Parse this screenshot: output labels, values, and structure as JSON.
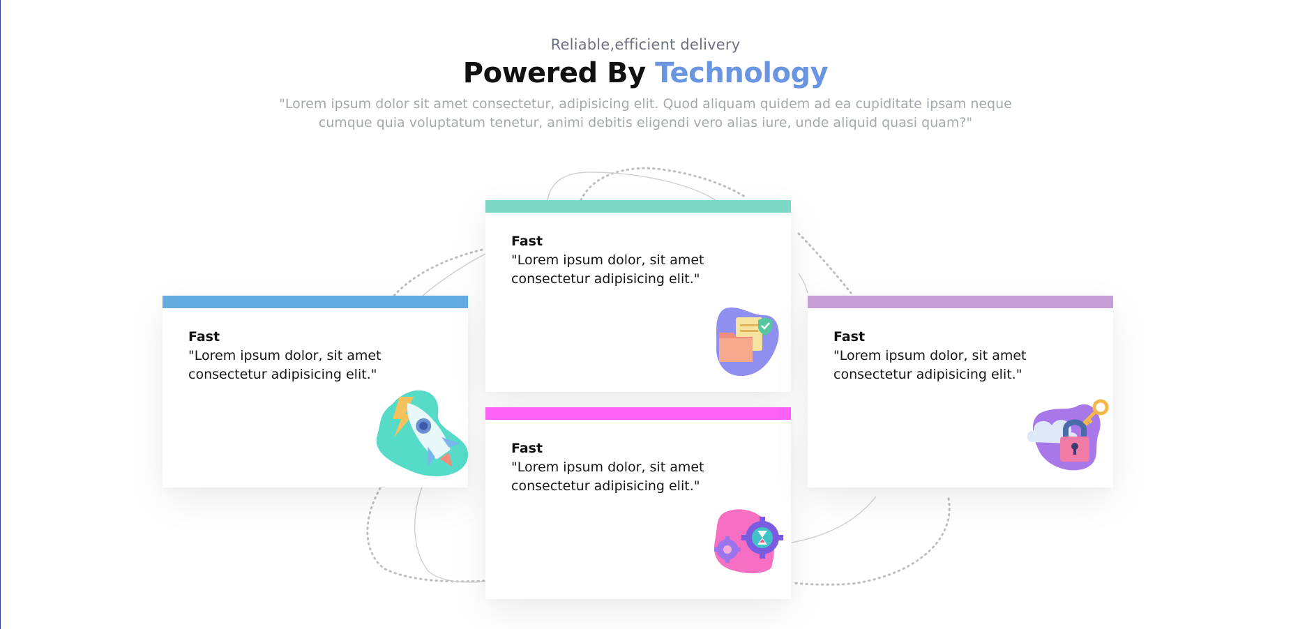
{
  "header": {
    "eyebrow": "Reliable,efficient delivery",
    "title_main": "Powered By ",
    "title_accent": "Technology",
    "lead": "\"Lorem ipsum dolor sit amet consectetur, adipisicing elit. Quod aliquam quidem ad ea cupiditate ipsam neque cumque quia voluptatum tenetur, animi debitis eligendi vero alias iure, unde aliquid quasi quam?\""
  },
  "colors": {
    "accent": "#6a95e0",
    "card_blue": "#64ade0",
    "card_teal": "#7dd8c5",
    "card_pink": "#fa62f5",
    "card_purple": "#c49ed4"
  },
  "cards": [
    {
      "heading": "Fast",
      "text": "\"Lorem ipsum dolor, sit amet consectetur adipisicing elit.\"",
      "icon": "rocket-icon"
    },
    {
      "heading": "Fast",
      "text": "\"Lorem ipsum dolor, sit amet consectetur adipisicing elit.\"",
      "icon": "secure-folder-icon"
    },
    {
      "heading": "Fast",
      "text": "\"Lorem ipsum dolor, sit amet consectetur adipisicing elit.\"",
      "icon": "gears-hourglass-icon"
    },
    {
      "heading": "Fast",
      "text": "\"Lorem ipsum dolor, sit amet consectetur adipisicing elit.\"",
      "icon": "cloud-lock-icon"
    }
  ]
}
